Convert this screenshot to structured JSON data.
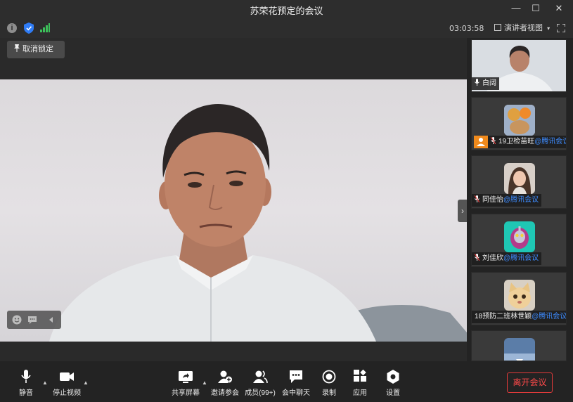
{
  "window": {
    "title": "苏荣花预定的会议",
    "minimize_label": "—",
    "maximize_label": "☐",
    "close_label": "✕"
  },
  "infobar": {
    "timer": "03:03:58",
    "view_label": "演讲者视图",
    "view_caret": "▾",
    "info_glyph": "i",
    "signal_color": "#3cc05a",
    "shield_color": "#2f7cf6"
  },
  "stage": {
    "unlock_label": "取消锁定",
    "expand_glyph": "›"
  },
  "participants": [
    {
      "name": "白阔",
      "org": ""
    },
    {
      "name": "19卫检苗旺",
      "org": "@腾讯会议"
    },
    {
      "name": "同佳怡",
      "org": "@腾讯会议"
    },
    {
      "name": "刘佳欣",
      "org": "@腾讯会议"
    },
    {
      "name": "18预防二班林世颖",
      "org": "@腾讯会议"
    }
  ],
  "toolbar": {
    "mute_label": "静音",
    "stop_video_label": "停止视频",
    "share_label": "共享屏幕",
    "invite_label": "邀请参会",
    "members_label": "成员(99+)",
    "chat_label": "会中聊天",
    "record_label": "录制",
    "apps_label": "应用",
    "settings_label": "设置",
    "leave_label": "离开会议",
    "caret": "▲"
  },
  "colors": {
    "leave_red": "#e03a3a",
    "org_blue": "#3e8cff",
    "host_orange": "#f08a1c"
  }
}
